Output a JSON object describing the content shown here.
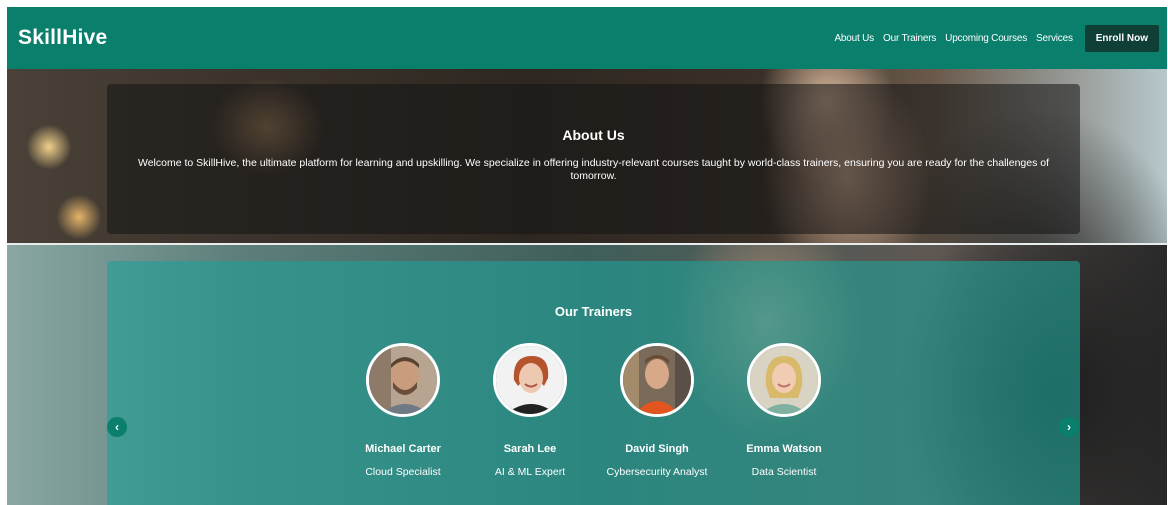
{
  "header": {
    "brand": "SkillHive",
    "nav": [
      "About Us",
      "Our Trainers",
      "Upcoming Courses",
      "Services"
    ],
    "cta": "Enroll Now"
  },
  "about": {
    "title": "About Us",
    "text": "Welcome to SkillHive, the ultimate platform for learning and upskilling. We specialize in offering industry-relevant courses taught by world-class trainers, ensuring you are ready for the challenges of tomorrow."
  },
  "trainers": {
    "title": "Our Trainers",
    "items": [
      {
        "name": "Michael Carter",
        "role": "Cloud Specialist"
      },
      {
        "name": "Sarah Lee",
        "role": "AI & ML Expert"
      },
      {
        "name": "David Singh",
        "role": "Cybersecurity Analyst"
      },
      {
        "name": "Emma Watson",
        "role": "Data Scientist"
      }
    ]
  },
  "carousel": {
    "prev_icon": "chevron-left-icon",
    "next_icon": "chevron-right-icon"
  },
  "colors": {
    "brand": "#0a7f6b",
    "cta_bg": "#0f3f36"
  }
}
